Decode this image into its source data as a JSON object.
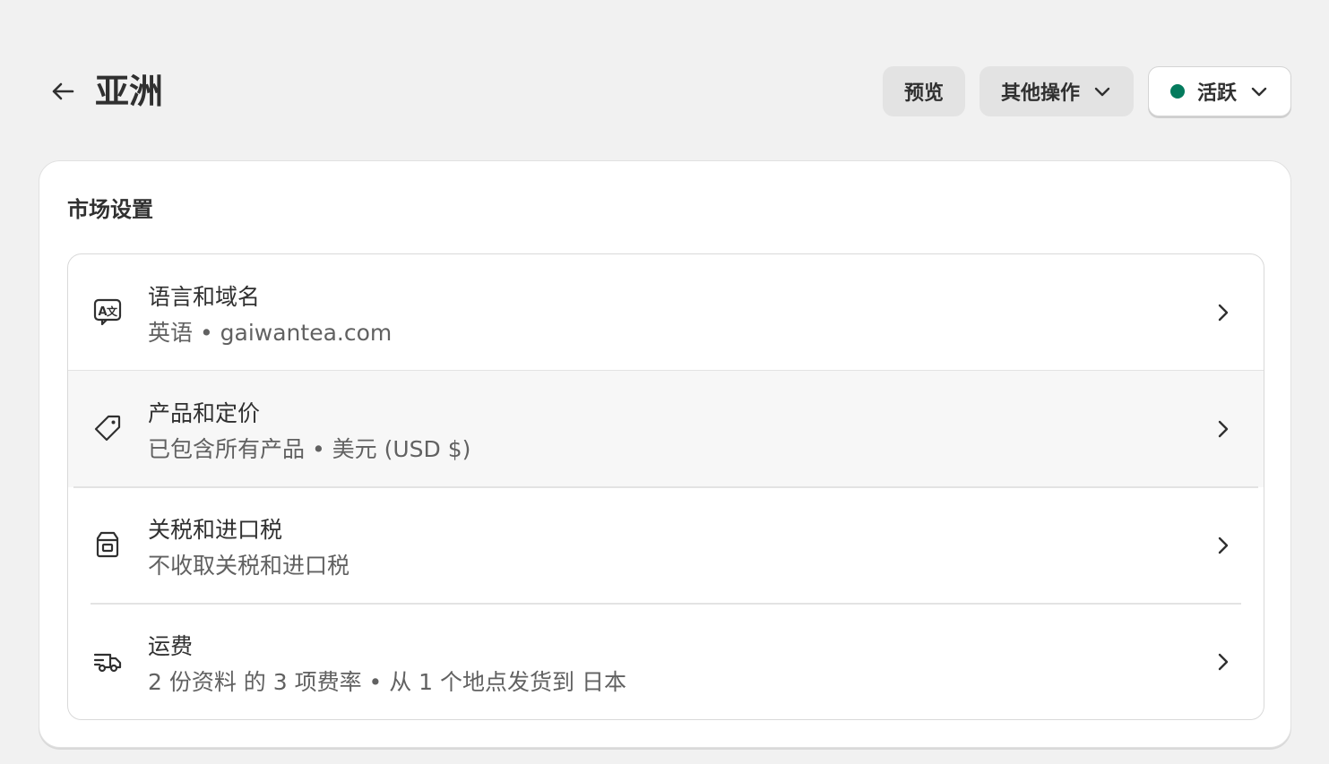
{
  "header": {
    "title": "亚洲",
    "back_icon": "arrow-left-icon",
    "preview_label": "预览",
    "more_actions_label": "其他操作",
    "status_label": "活跃",
    "status_color": "#047b5d"
  },
  "settings": {
    "title": "市场设置",
    "rows": [
      {
        "icon": "language-icon",
        "title": "语言和域名",
        "subtitle": "英语 • gaiwantea.com"
      },
      {
        "icon": "price-tag-icon",
        "title": "产品和定价",
        "subtitle": "已包含所有产品 • 美元 (USD $)"
      },
      {
        "icon": "duties-box-icon",
        "title": "关税和进口税",
        "subtitle": "不收取关税和进口税"
      },
      {
        "icon": "delivery-truck-icon",
        "title": "运费",
        "subtitle": "2 份资料 的 3 项费率 • 从 1 个地点发货到 日本"
      }
    ]
  }
}
